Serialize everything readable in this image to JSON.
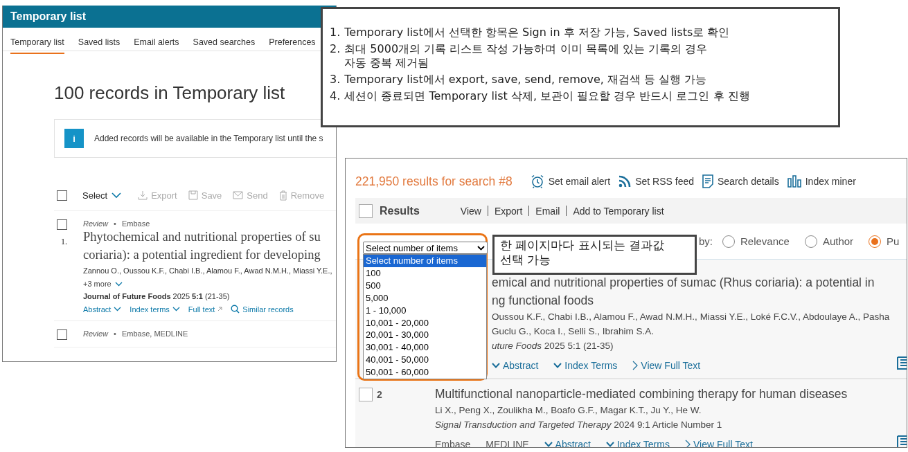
{
  "left_panel": {
    "header_title": "Temporary list",
    "tabs": [
      {
        "label": "Temporary list",
        "selected": true
      },
      {
        "label": "Saved lists",
        "selected": false
      },
      {
        "label": "Email alerts",
        "selected": false
      },
      {
        "label": "Saved searches",
        "selected": false
      },
      {
        "label": "Preferences",
        "selected": false
      }
    ],
    "heading": "100 records in Temporary list",
    "info_icon": "i",
    "info_text": "Added records will be available in the Temporary list until the s",
    "select_all_checked": false,
    "select_label": "Select",
    "actions": [
      {
        "kind": "export",
        "label": "Export",
        "disabled": true
      },
      {
        "kind": "save",
        "label": "Save",
        "disabled": true
      },
      {
        "kind": "send",
        "label": "Send",
        "disabled": true
      },
      {
        "kind": "remove",
        "label": "Remove",
        "disabled": true
      }
    ],
    "records": [
      {
        "checked": false,
        "type": "Review",
        "separator": "•",
        "sources": "Embase",
        "number": "1.",
        "title_lines": [
          "Phytochemical and nutritional properties of su",
          "coriaria): a potential ingredient for developing"
        ],
        "authors": "Zannou O., Oussou K.F., Chabi I.B., Alamou F., Awad N.M.H., Miassi Y.E.,",
        "more": "+3 more",
        "journal": "**Journal of Future Foods** 2025 **5:1** (21-35)",
        "links": [
          {
            "kind": "toggle",
            "label": "Abstract"
          },
          {
            "kind": "toggle",
            "label": "Index terms"
          },
          {
            "kind": "external",
            "label": "Full text"
          },
          {
            "kind": "search",
            "label": "Similar records"
          }
        ]
      },
      {
        "checked": false,
        "type": "Review",
        "separator": "•",
        "sources": "Embase, MEDLINE"
      }
    ]
  },
  "annotations": [
    {
      "items": [
        {
          "marker": "1.",
          "lines": [
            "Temporary list에서 선택한 항목은 Sign in 후 저장 가능,  Saved lists로 확인"
          ]
        },
        {
          "marker": "2.",
          "lines": [
            "최대 5000개의 기록 리스트 작성 가능하며 이미 목록에 있는 기록의 경우",
            "자동 중복 제거됨"
          ]
        },
        {
          "marker": "3.",
          "lines": [
            "Temporary list에서 export, save, send, remove, 재검색 등 실행 가능"
          ]
        },
        {
          "marker": "4.",
          "lines": [
            "세션이 종료되면 Temporary list 삭제, 보관이 필요할 경우 반드시 로그인 후 진행"
          ]
        }
      ]
    },
    {
      "text": "한 페이지마다 표시되는 결과값 선택 가능"
    }
  ],
  "right_panel": {
    "results_count": "221,950 results for search #8",
    "tools": [
      {
        "kind": "alarm",
        "label": "Set email alert"
      },
      {
        "kind": "rss",
        "label": "Set RSS feed"
      },
      {
        "kind": "details",
        "label": "Search details"
      },
      {
        "kind": "bars",
        "label": "Index miner"
      }
    ],
    "select_all_checked": false,
    "results_label": "Results",
    "actions": [
      "View",
      "Export",
      "Email",
      "Add to Temporary list"
    ],
    "sort_label": "by:",
    "sort_options": [
      {
        "label": "Relevance",
        "selected": false
      },
      {
        "label": "Author",
        "selected": false
      },
      {
        "label": "Pu",
        "selected": true
      }
    ],
    "results": [
      {
        "title_lines": [
          "emical and nutritional properties of sumac (Rhus coriaria): a potential in",
          "ng functional foods"
        ],
        "authors_lines": [
          "Oussou K.F., Chabi I.B., Alamou F., Awad N.M.H., Miassi Y.E., Loké F.C.V., Abdoulaye A., Pasha",
          "Guclu G., Koca I., Selli S., Ibrahim S.A."
        ],
        "journal": "*uture Foods* 2025 5:1 (21-35)",
        "links": [
          {
            "kind": "toggle",
            "label": "Abstract"
          },
          {
            "kind": "toggle",
            "label": "Index Terms"
          },
          {
            "kind": "open",
            "label": "View Full Text"
          }
        ]
      },
      {
        "checked": false,
        "number": "2",
        "title_lines": [
          "Multifunctional nanoparticle-mediated combining therapy for human diseases"
        ],
        "authors_lines": [
          "Li X., Peng X., Zoulikha M., Boafo G.F., Magar K.T., Ju Y., He W."
        ],
        "journal": "*Signal Transduction and Targeted Therapy* 2024 9:1 Article Number 1",
        "sources": [
          "Embase",
          "MEDLINE"
        ],
        "links": [
          {
            "kind": "toggle",
            "label": "Abstract"
          },
          {
            "kind": "toggle",
            "label": "Index Terms"
          },
          {
            "kind": "open",
            "label": "View Full Text"
          }
        ]
      }
    ]
  },
  "items_dropdown": {
    "value": "Select number of items",
    "options": [
      {
        "label": "Select number of items",
        "selected": true
      },
      {
        "label": "100",
        "selected": false
      },
      {
        "label": "500",
        "selected": false
      },
      {
        "label": "5,000",
        "selected": false
      },
      {
        "label": "1 - 10,000",
        "selected": false
      },
      {
        "label": "10,001 - 20,000",
        "selected": false
      },
      {
        "label": "20,001 - 30,000",
        "selected": false
      },
      {
        "label": "30,001 - 40,000",
        "selected": false
      },
      {
        "label": "40,001 - 50,000",
        "selected": false
      },
      {
        "label": "50,001 - 60,000",
        "selected": false
      }
    ]
  }
}
